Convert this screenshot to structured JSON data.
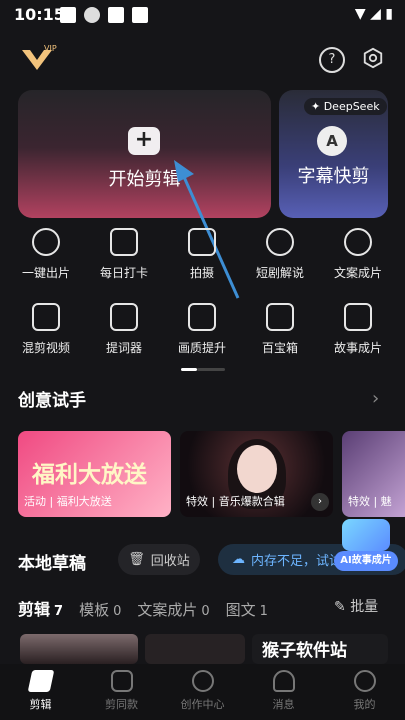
{
  "status": {
    "time": "10:15"
  },
  "header": {
    "vip_badge": "VIP",
    "help_symbol": "?"
  },
  "hero": {
    "main_card": {
      "plus": "+",
      "label": "开始剪辑"
    },
    "side_card": {
      "badge": "✦ DeepSeek",
      "icon_letter": "A",
      "label": "字幕快剪"
    }
  },
  "tools": [
    {
      "label": "一键出片",
      "icon": "lightning-icon"
    },
    {
      "label": "每日打卡",
      "icon": "checkbox-icon"
    },
    {
      "label": "拍摄",
      "icon": "camera-icon"
    },
    {
      "label": "短剧解说",
      "icon": "film-reel-icon"
    },
    {
      "label": "文案成片",
      "icon": "text-ai-icon"
    },
    {
      "label": "混剪视频",
      "icon": "clapper-icon"
    },
    {
      "label": "提词器",
      "icon": "prompter-icon"
    },
    {
      "label": "画质提升",
      "icon": "hd-icon"
    },
    {
      "label": "百宝箱",
      "icon": "toolbox-icon"
    },
    {
      "label": "故事成片",
      "icon": "play-ai-icon"
    }
  ],
  "creative": {
    "title": "创意试手",
    "promos": [
      {
        "title": "福利大放送",
        "tag": "活动 | 福利大放送"
      },
      {
        "tag": "特效 | 音乐爆款合辑"
      },
      {
        "tag": "特效 | 魅"
      }
    ]
  },
  "drafts": {
    "title": "本地草稿",
    "recycle_label": "回收站",
    "storage_warning": "内存不足，试试",
    "ai_float_label": "AI故事成片",
    "tabs": [
      {
        "label": "剪辑",
        "count": "7"
      },
      {
        "label": "模板",
        "count": "0"
      },
      {
        "label": "文案成片",
        "count": "0"
      },
      {
        "label": "图文",
        "count": "1"
      }
    ],
    "batch_label": "批量"
  },
  "watermark": "猴子软件站",
  "nav": [
    {
      "label": "剪辑",
      "icon": "edit-icon",
      "active": true
    },
    {
      "label": "剪同款",
      "icon": "template-icon"
    },
    {
      "label": "创作中心",
      "icon": "creator-icon"
    },
    {
      "label": "消息",
      "icon": "bell-icon"
    },
    {
      "label": "我的",
      "icon": "profile-icon"
    }
  ],
  "colors": {
    "bg": "#151518",
    "accent_pink": "#b24260",
    "accent_blue": "#5b8cff"
  }
}
